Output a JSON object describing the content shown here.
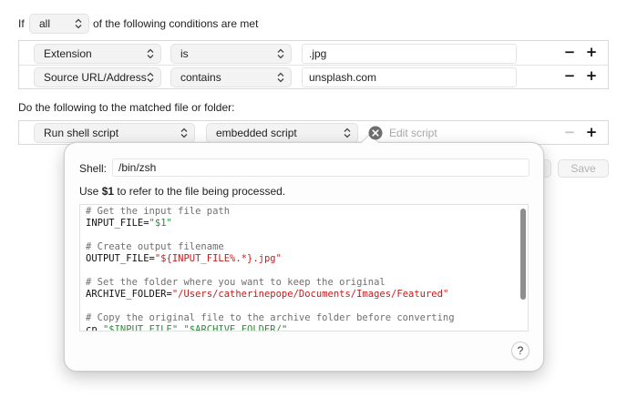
{
  "conditions": {
    "prefix": "If",
    "match_value": "all",
    "suffix": "of the following conditions are met",
    "rows": [
      {
        "attribute": "Extension",
        "operator": "is",
        "value": ".jpg"
      },
      {
        "attribute": "Source URL/Address",
        "operator": "contains",
        "value": "unsplash.com"
      }
    ]
  },
  "actions": {
    "heading": "Do the following to the matched file or folder:",
    "action": "Run shell script",
    "script_type": "embedded script",
    "edit_placeholder": "Edit script",
    "save_label": "Save"
  },
  "editor": {
    "shell_label": "Shell:",
    "shell_value": "/bin/zsh",
    "hint_prefix": "Use ",
    "hint_var": "$1",
    "hint_suffix": " to refer to the file being processed.",
    "help_label": "?",
    "code": {
      "l1": "# Get the input file path",
      "l2a": "INPUT_FILE=",
      "l2b": "\"$1\"",
      "l3": "# Create output filename",
      "l4a": "OUTPUT_FILE=",
      "l4b": "\"${INPUT_FILE%.*}.jpg\"",
      "l5": "# Set the folder where you want to keep the original",
      "l6a": "ARCHIVE_FOLDER=",
      "l6b": "\"/Users/catherinepope/Documents/Images/Featured\"",
      "l7": "# Copy the original file to the archive folder before converting",
      "l8a": "cp ",
      "l8b": "\"$INPUT_FILE\"",
      "l8c": " ",
      "l8d": "\"$ARCHIVE_FOLDER/\""
    }
  },
  "icons": {
    "chevron": "chevron-updown-icon",
    "remove": "minus-icon",
    "add": "plus-icon",
    "close": "close-circle-icon"
  }
}
